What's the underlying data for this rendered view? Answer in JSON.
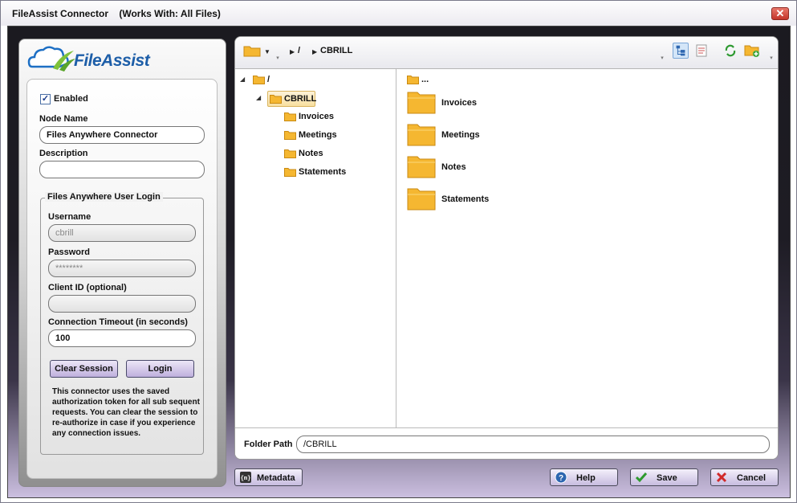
{
  "window": {
    "title": "FileAssist Connector    (Works With: All Files)",
    "close_label": "✕"
  },
  "logo": {
    "text": "FileAssist"
  },
  "form": {
    "enabled_label": "Enabled",
    "enabled_checked": true,
    "node_name_label": "Node Name",
    "node_name_value": "Files Anywhere Connector",
    "description_label": "Description",
    "description_value": "",
    "login_group_title": "Files Anywhere User Login",
    "username_label": "Username",
    "username_value": "cbrill",
    "password_label": "Password",
    "password_value": "********",
    "client_id_label": "Client ID (optional)",
    "client_id_value": "",
    "timeout_label": "Connection Timeout (in seconds)",
    "timeout_value": "100",
    "clear_session_label": "Clear Session",
    "login_label": "Login",
    "note": "This connector uses the saved authorization token for all sub sequent requests. You can clear the session to re-authorize in case if you experience any connection issues."
  },
  "browser": {
    "breadcrumb": [
      "/",
      "CBRILL"
    ],
    "tree": {
      "root": "/",
      "selected": "CBRILL",
      "children": [
        "Invoices",
        "Meetings",
        "Notes",
        "Statements"
      ]
    },
    "list_parent": "...",
    "list_items": [
      "Invoices",
      "Meetings",
      "Notes",
      "Statements"
    ],
    "folder_path_label": "Folder Path",
    "folder_path_value": "/CBRILL"
  },
  "footer": {
    "metadata_label": "Metadata",
    "help_label": "Help",
    "save_label": "Save",
    "cancel_label": "Cancel"
  },
  "colors": {
    "folder": "#f5b731",
    "accent": "#1d5ea8",
    "button": "#c7bcdf"
  },
  "icons": [
    "close-icon",
    "folder-icon",
    "tree-view-icon",
    "details-view-icon",
    "refresh-icon",
    "new-folder-icon",
    "metadata-icon",
    "help-icon",
    "check-icon",
    "x-icon"
  ]
}
